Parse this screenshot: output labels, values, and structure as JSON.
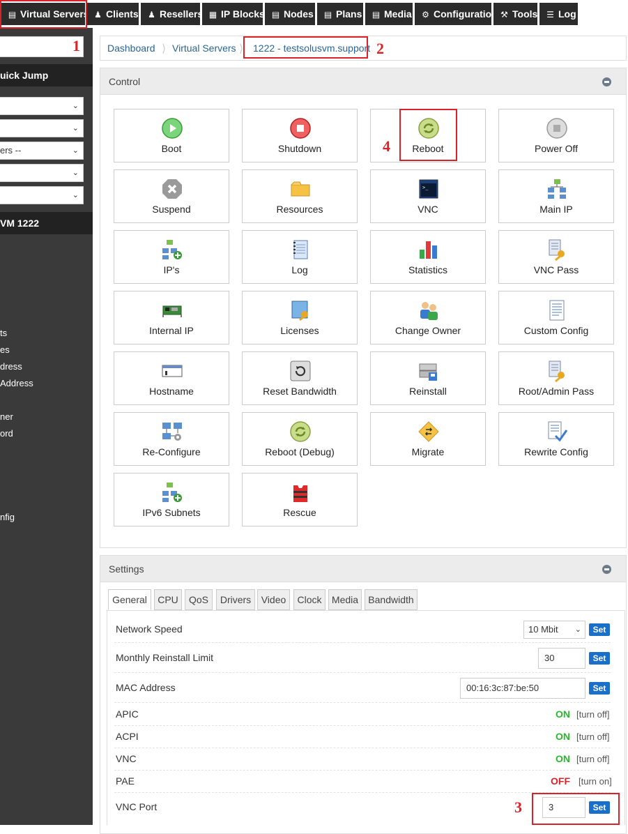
{
  "nav": {
    "items": [
      {
        "label": "Virtual Servers",
        "icon": "server-icon"
      },
      {
        "label": "Clients",
        "icon": "users-icon"
      },
      {
        "label": "Resellers",
        "icon": "user-icon"
      },
      {
        "label": "IP Blocks",
        "icon": "grid-icon"
      },
      {
        "label": "Nodes",
        "icon": "server-icon"
      },
      {
        "label": "Plans",
        "icon": "server-icon"
      },
      {
        "label": "Media",
        "icon": "file-icon"
      },
      {
        "label": "Configuration",
        "icon": "gear-icon"
      },
      {
        "label": "Tools",
        "icon": "wrench-icon"
      },
      {
        "label": "Log",
        "icon": "list-icon"
      }
    ]
  },
  "sidebar": {
    "quick_jump": "uick Jump",
    "selects": [
      "",
      "",
      "ers --",
      "",
      ""
    ],
    "vm_header": "VM 1222",
    "links": [
      "ts",
      "es",
      "dress",
      "Address",
      "ner",
      "ord",
      "nfig"
    ]
  },
  "breadcrumb": {
    "items": [
      "Dashboard",
      "Virtual Servers",
      "1222 - testsolusvm.support"
    ]
  },
  "control": {
    "title": "Control",
    "tiles": [
      {
        "label": "Boot",
        "icon": "play-icon"
      },
      {
        "label": "Shutdown",
        "icon": "stop-icon"
      },
      {
        "label": "Reboot",
        "icon": "reboot-icon"
      },
      {
        "label": "Power Off",
        "icon": "power-off-icon"
      },
      {
        "label": "Suspend",
        "icon": "suspend-icon"
      },
      {
        "label": "Resources",
        "icon": "folder-icon"
      },
      {
        "label": "VNC",
        "icon": "terminal-icon"
      },
      {
        "label": "Main IP",
        "icon": "network-icon"
      },
      {
        "label": "IP's",
        "icon": "network-add-icon"
      },
      {
        "label": "Log",
        "icon": "notebook-icon"
      },
      {
        "label": "Statistics",
        "icon": "bar-chart-icon"
      },
      {
        "label": "VNC Pass",
        "icon": "key-document-icon"
      },
      {
        "label": "Internal IP",
        "icon": "network-card-icon"
      },
      {
        "label": "Licenses",
        "icon": "license-key-icon"
      },
      {
        "label": "Change Owner",
        "icon": "change-owner-icon"
      },
      {
        "label": "Custom Config",
        "icon": "document-icon"
      },
      {
        "label": "Hostname",
        "icon": "hostname-icon"
      },
      {
        "label": "Reset Bandwidth",
        "icon": "reset-icon"
      },
      {
        "label": "Reinstall",
        "icon": "reinstall-icon"
      },
      {
        "label": "Root/Admin Pass",
        "icon": "key-document-icon"
      },
      {
        "label": "Re-Configure",
        "icon": "reconfigure-icon"
      },
      {
        "label": "Reboot (Debug)",
        "icon": "reboot-icon"
      },
      {
        "label": "Migrate",
        "icon": "migrate-icon"
      },
      {
        "label": "Rewrite Config",
        "icon": "rewrite-icon"
      },
      {
        "label": "IPv6 Subnets",
        "icon": "network-add-icon"
      },
      {
        "label": "Rescue",
        "icon": "rescue-icon"
      }
    ]
  },
  "settings": {
    "title": "Settings",
    "tabs": [
      "General",
      "CPU",
      "QoS",
      "Drivers",
      "Video",
      "Clock",
      "Media",
      "Bandwidth"
    ],
    "network_speed": {
      "label": "Network Speed",
      "value": "10 Mbit",
      "button": "Set"
    },
    "reinstall_limit": {
      "label": "Monthly Reinstall Limit",
      "value": "30",
      "button": "Set"
    },
    "mac": {
      "label": "MAC Address",
      "value": "00:16:3c:87:be:50",
      "button": "Set"
    },
    "toggles": [
      {
        "label": "APIC",
        "state": "ON",
        "action": "[turn off]"
      },
      {
        "label": "ACPI",
        "state": "ON",
        "action": "[turn off]"
      },
      {
        "label": "VNC",
        "state": "ON",
        "action": "[turn off]"
      },
      {
        "label": "PAE",
        "state": "OFF",
        "action": "[turn on]"
      }
    ],
    "vnc_port": {
      "label": "VNC Port",
      "value": "3",
      "button": "Set"
    }
  },
  "annotations": [
    "1",
    "2",
    "3",
    "4"
  ],
  "colors": {
    "nav_bg": "#2b2b2b",
    "sidebar_bg": "#3a3a3a",
    "link": "#2a6496",
    "set_button": "#1a6fc9",
    "on": "#2db52d",
    "off": "#d9232a",
    "annotation": "#d9232a"
  }
}
